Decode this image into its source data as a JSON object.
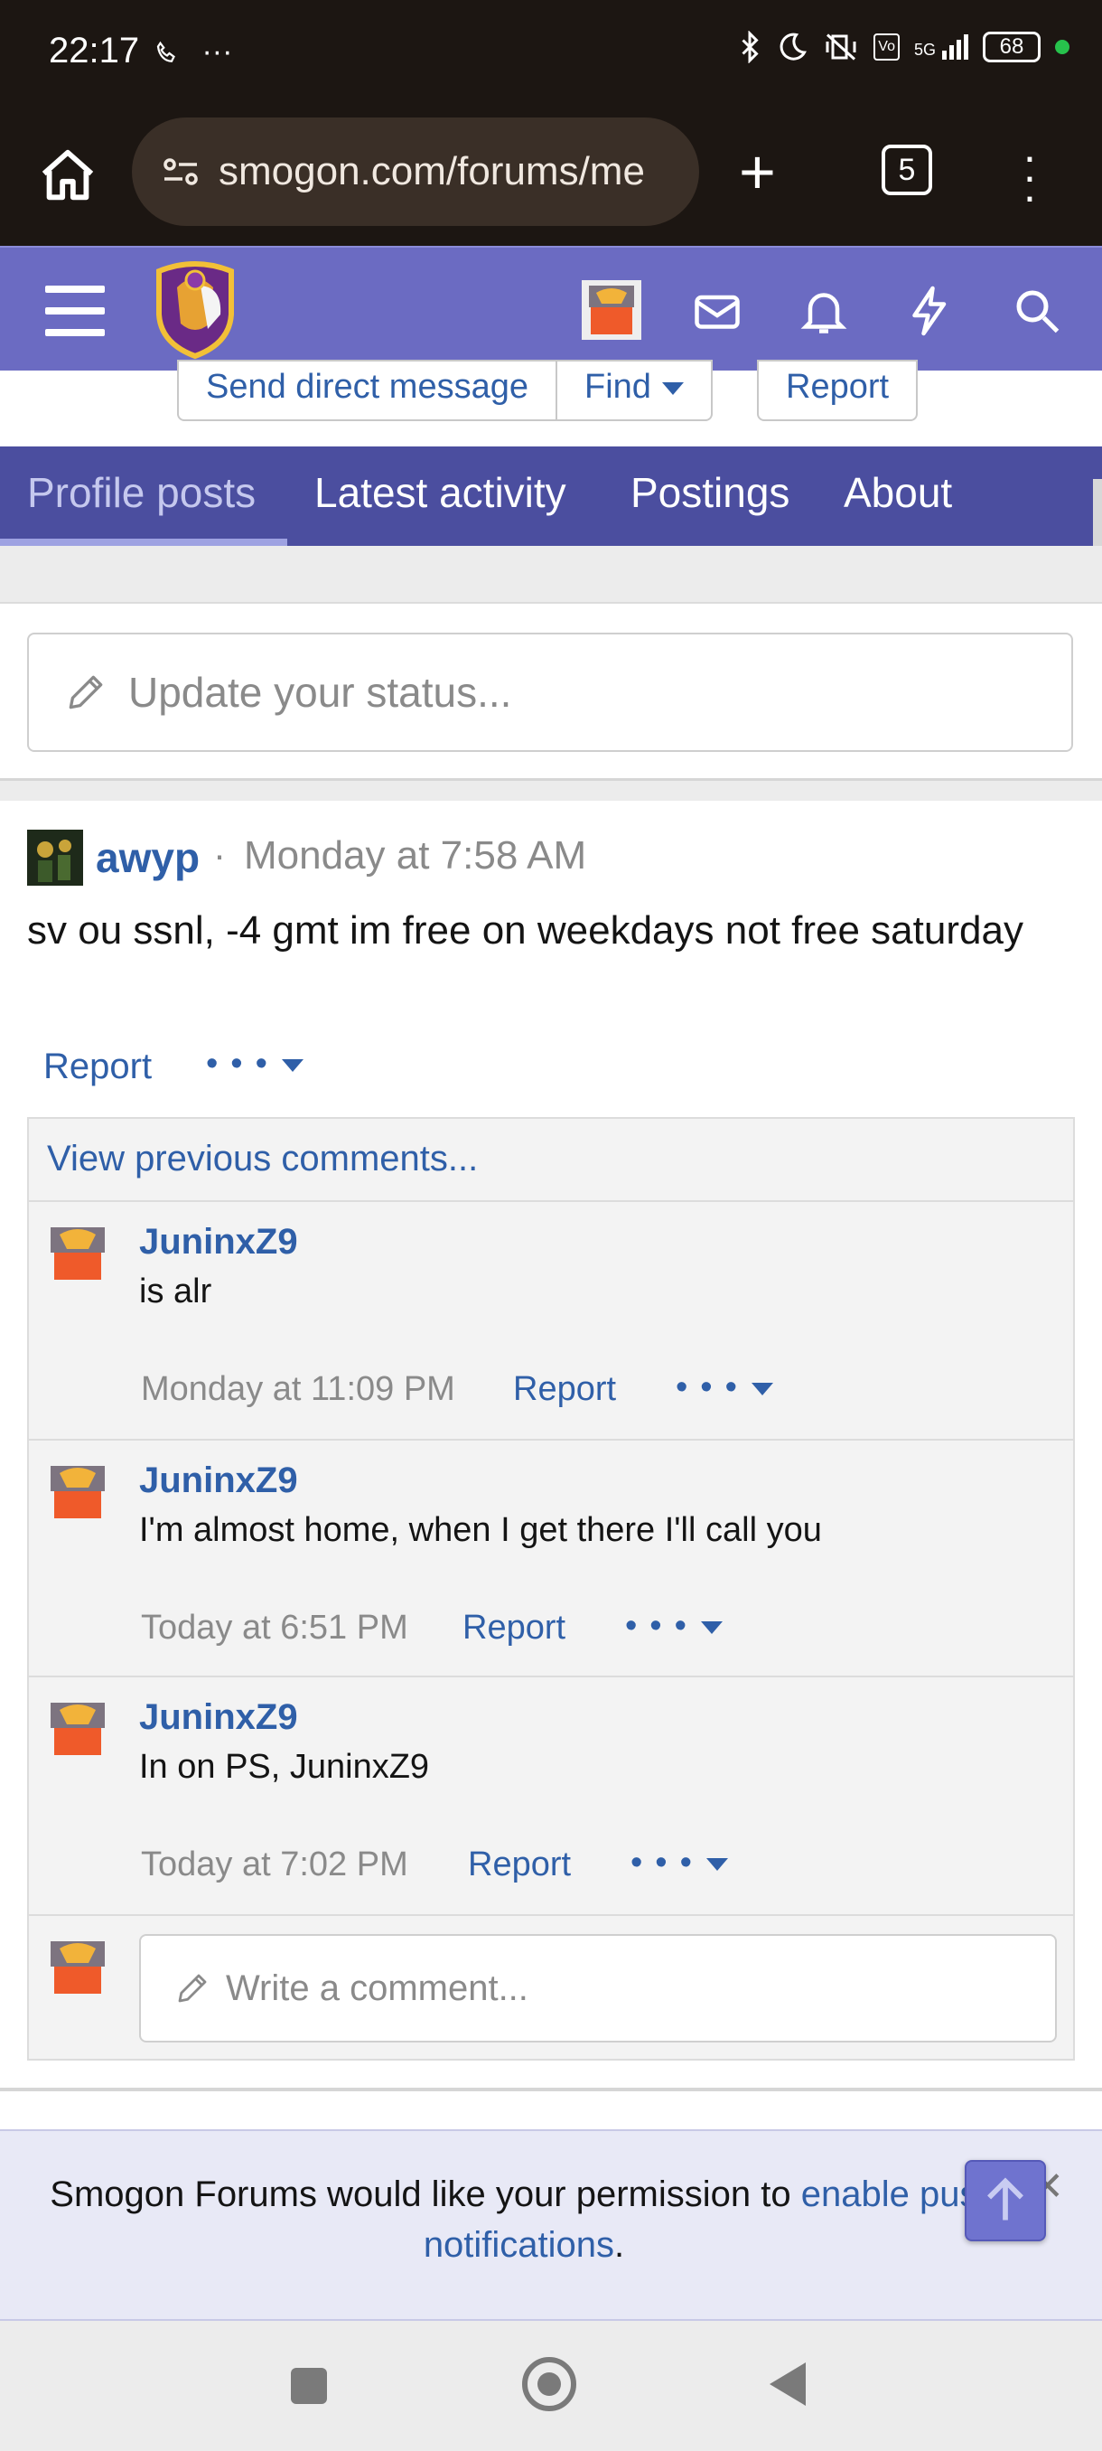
{
  "status_bar": {
    "time": "22:17",
    "call_icon": "phone-icon",
    "more": "···",
    "signal_label": "5G",
    "battery": "68"
  },
  "browser": {
    "url": "smogon.com/forums/me",
    "tab_count": "5"
  },
  "profile_actions": {
    "send_dm": "Send direct message",
    "find": "Find",
    "report": "Report"
  },
  "tabs": [
    {
      "label": "Profile posts"
    },
    {
      "label": "Latest activity"
    },
    {
      "label": "Postings"
    },
    {
      "label": "About"
    }
  ],
  "status_update": {
    "placeholder": "Update your status..."
  },
  "post": {
    "user": "awyp",
    "separator": "·",
    "time": "Monday at 7:58 AM",
    "text": "sv ou ssnl, -4 gmt im free on weekdays not free saturday",
    "report": "Report",
    "more": "•••"
  },
  "comments": {
    "view_previous": "View previous comments...",
    "items": [
      {
        "user": "JuninxZ9",
        "text": "is alr",
        "time": "Monday at 11:09 PM",
        "report": "Report",
        "more": "•••"
      },
      {
        "user": "JuninxZ9",
        "text": "I'm almost home, when I get there I'll call you",
        "time": "Today at 6:51 PM",
        "report": "Report",
        "more": "•••"
      },
      {
        "user": "JuninxZ9",
        "text": "In on PS, JuninxZ9",
        "time": "Today at 7:02 PM",
        "report": "Report",
        "more": "•••"
      }
    ],
    "write_placeholder": "Write a comment..."
  },
  "push_notice": {
    "text_before": "Smogon Forums would like your permission to ",
    "link": "enable push notifications",
    "text_after": ".",
    "close": "✕"
  },
  "colors": {
    "header": "#6b6bc2",
    "tabbar": "#4b4e9f",
    "link": "#2f5fa8",
    "browser_bg": "#1c1612"
  }
}
